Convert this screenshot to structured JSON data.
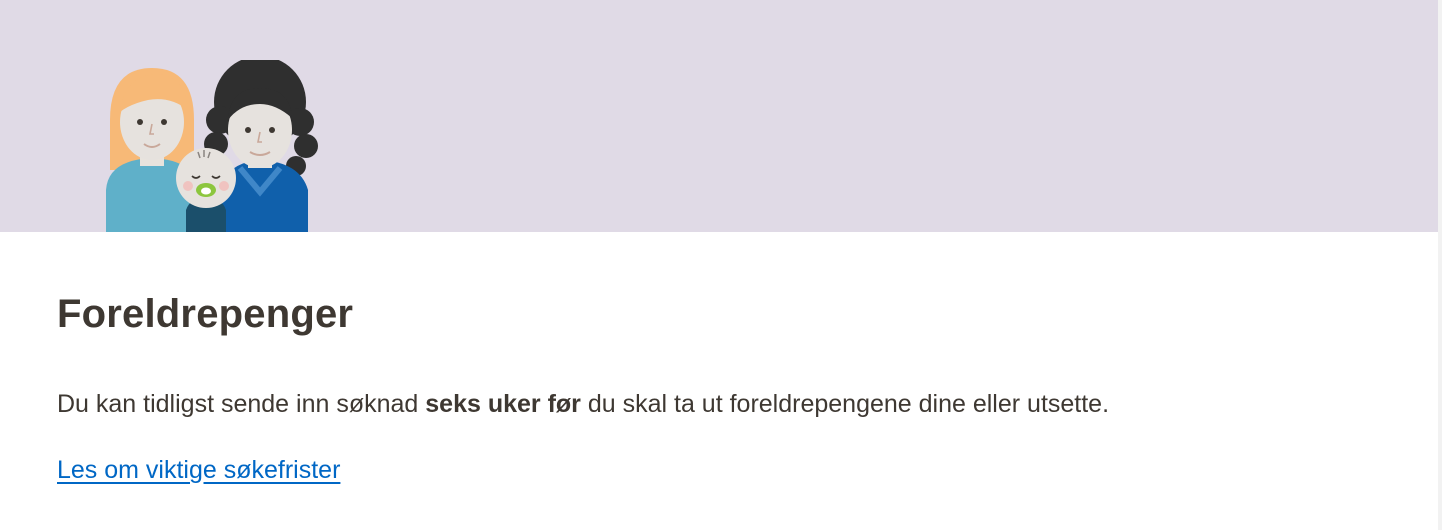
{
  "hero": {
    "illustration": "family-illustration-icon",
    "background_color": "#e0dae6"
  },
  "card": {
    "title": "Foreldrepenger",
    "body": {
      "prefix": "Du kan tidligst sende inn søknad ",
      "bold": "seks uker før",
      "suffix": " du skal ta ut foreldrepengene dine eller utsette."
    },
    "link": "Les om viktige søkefrister"
  },
  "colors": {
    "text": "#3e3832",
    "link": "#0067c5"
  }
}
